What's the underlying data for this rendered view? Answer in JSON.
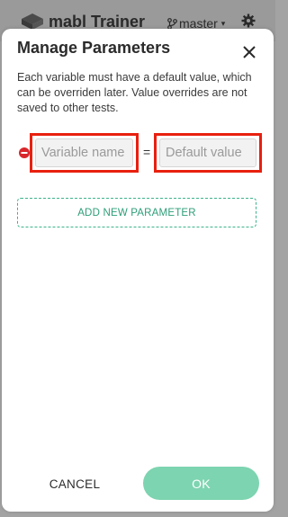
{
  "app": {
    "title": "mabl Trainer",
    "branch": "master",
    "branch_caret": "▾"
  },
  "modal": {
    "title": "Manage Parameters",
    "description": "Each variable must have a default value, which can be overriden later. Value overrides are not saved to other tests.",
    "parameters": [
      {
        "name_placeholder": "Variable name",
        "name_value": "",
        "equals": "=",
        "value_placeholder": "Default value",
        "value_value": ""
      }
    ],
    "add_parameter_label": "ADD NEW PARAMETER",
    "cancel_label": "CANCEL",
    "ok_label": "OK"
  },
  "colors": {
    "accent": "#3cb38a",
    "ok_button": "#7dd4b0",
    "highlight": "#e8200f",
    "remove": "#d9262b"
  },
  "icons": {
    "logo": "mabl-logo-icon",
    "branch": "git-branch-icon",
    "settings": "gear-icon",
    "close": "close-icon",
    "remove": "remove-circle-icon"
  }
}
